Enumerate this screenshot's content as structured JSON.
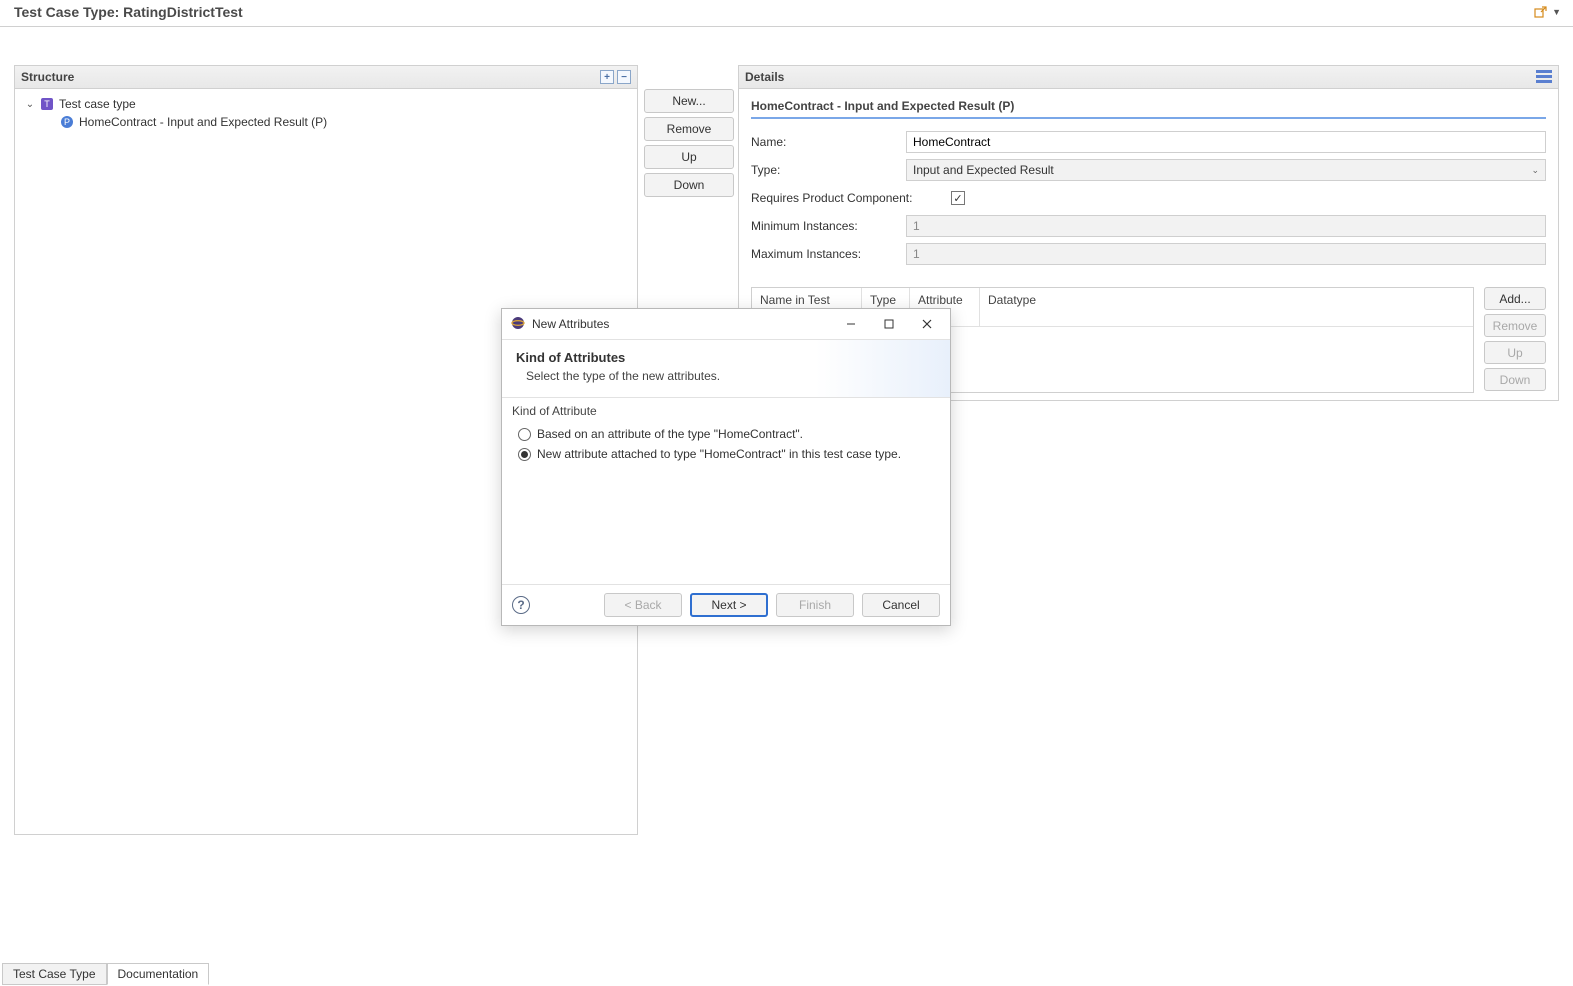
{
  "header": {
    "title": "Test Case Type: RatingDistrictTest"
  },
  "structure": {
    "title": "Structure",
    "root": {
      "label": "Test case type"
    },
    "child": {
      "label": "HomeContract - Input and Expected Result (P)"
    }
  },
  "midButtons": {
    "new": "New...",
    "remove": "Remove",
    "up": "Up",
    "down": "Down"
  },
  "details": {
    "title": "Details",
    "sectionTitle": "HomeContract - Input and Expected Result (P)",
    "nameLabel": "Name:",
    "nameValue": "HomeContract",
    "typeLabel": "Type:",
    "typeValue": "Input and Expected Result",
    "requiresLabel": "Requires Product Component:",
    "requiresChecked": "✓",
    "minLabel": "Minimum Instances:",
    "minValue": "1",
    "maxLabel": "Maximum Instances:",
    "maxValue": "1",
    "columns": {
      "nameInTestCase": "Name in Test Case",
      "type": "Type",
      "attribute": "Attribute",
      "datatype": "Datatype"
    },
    "attrButtons": {
      "add": "Add...",
      "remove": "Remove",
      "up": "Up",
      "down": "Down"
    }
  },
  "tabs": {
    "testCaseType": "Test Case Type",
    "documentation": "Documentation"
  },
  "dialog": {
    "title": "New Attributes",
    "heading": "Kind of Attributes",
    "subheading": "Select the type of the new attributes.",
    "groupLabel": "Kind of Attribute",
    "option1": "Based on an attribute of the type \"HomeContract\".",
    "option2": "New attribute attached to type \"HomeContract\" in this test case type.",
    "back": "< Back",
    "next": "Next >",
    "finish": "Finish",
    "cancel": "Cancel"
  }
}
